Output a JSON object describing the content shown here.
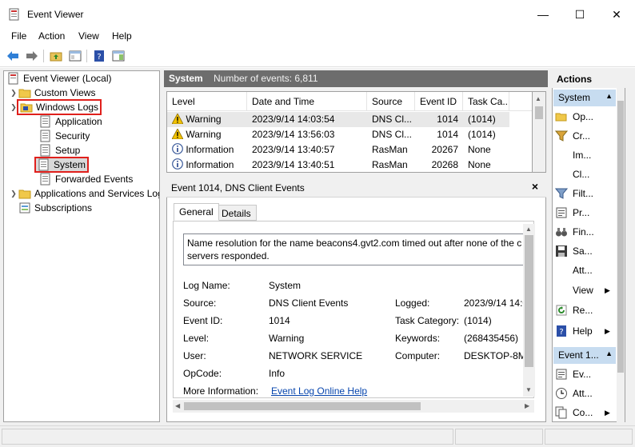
{
  "window": {
    "title": "Event Viewer",
    "minimize": "—",
    "maximize": "☐",
    "close": "✕"
  },
  "menu": [
    "File",
    "Action",
    "View",
    "Help"
  ],
  "tree": {
    "root": "Event Viewer (Local)",
    "custom_views": "Custom Views",
    "windows_logs": "Windows Logs",
    "application": "Application",
    "security": "Security",
    "setup": "Setup",
    "system": "System",
    "forwarded": "Forwarded Events",
    "apps_services": "Applications and Services Logs",
    "subscriptions": "Subscriptions"
  },
  "center": {
    "log_name": "System",
    "count_text": "Number of events: 6,811"
  },
  "grid": {
    "columns": [
      "Level",
      "Date and Time",
      "Source",
      "Event ID",
      "Task Ca..."
    ],
    "rows": [
      {
        "level": "Warning",
        "date": "2023/9/14 14:03:54",
        "source": "DNS Cl...",
        "id": "1014",
        "task": "(1014)",
        "icon": "warning-icon"
      },
      {
        "level": "Warning",
        "date": "2023/9/14 13:56:03",
        "source": "DNS Cl...",
        "id": "1014",
        "task": "(1014)",
        "icon": "warning-icon"
      },
      {
        "level": "Information",
        "date": "2023/9/14 13:40:57",
        "source": "RasMan",
        "id": "20267",
        "task": "None",
        "icon": "info-icon"
      },
      {
        "level": "Information",
        "date": "2023/9/14 13:40:51",
        "source": "RasMan",
        "id": "20268",
        "task": "None",
        "icon": "info-icon"
      }
    ]
  },
  "detail": {
    "header": "Event 1014, DNS Client Events",
    "close": "×",
    "tabs": [
      "General",
      "Details"
    ],
    "message_line1": "Name resolution for the name beacons4.gvt2.com timed out after none of the c",
    "message_line2": "servers responded.",
    "fields": {
      "log_name_label": "Log Name:",
      "log_name": "System",
      "source_label": "Source:",
      "source": "DNS Client Events",
      "logged_label": "Logged:",
      "logged": "2023/9/14 14:0",
      "event_id_label": "Event ID:",
      "event_id": "1014",
      "task_label": "Task Category:",
      "task": "(1014)",
      "level_label": "Level:",
      "level": "Warning",
      "keywords_label": "Keywords:",
      "keywords": "(268435456)",
      "user_label": "User:",
      "user": "NETWORK SERVICE",
      "computer_label": "Computer:",
      "computer": "DESKTOP-8M",
      "opcode_label": "OpCode:",
      "opcode": "Info",
      "more_info_label": "More Information:",
      "more_info_link": "Event Log Online Help"
    }
  },
  "actions": {
    "title": "Actions",
    "group1": "System",
    "items1": [
      "Op...",
      "Cr...",
      "Im...",
      "Cl...",
      "Filt...",
      "Pr...",
      "Fin...",
      "Sa...",
      "Att...",
      "View",
      "Re...",
      "Help"
    ],
    "group2": "Event 1...",
    "items2": [
      "Ev...",
      "Att...",
      "Co..."
    ]
  },
  "colors": {
    "highlight": "#e0201c",
    "header_bg": "#6d6d6d",
    "group_bg": "#c7dcf0",
    "link": "#0645ad"
  }
}
